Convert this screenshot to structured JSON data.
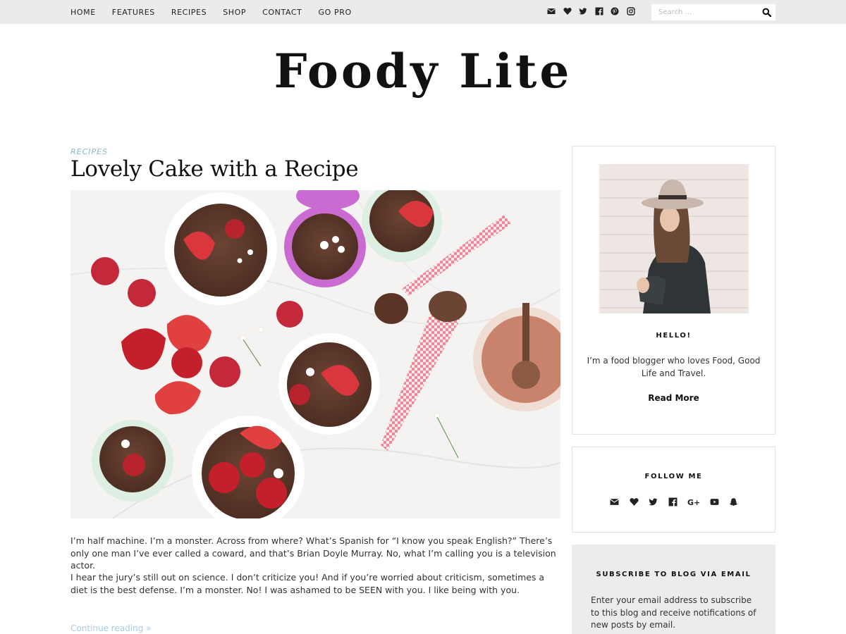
{
  "nav": {
    "items": [
      "HOME",
      "FEATURES",
      "RECIPES",
      "SHOP",
      "CONTACT",
      "GO PRO"
    ]
  },
  "top_social_icons": [
    "envelope-icon",
    "heart-icon",
    "twitter-icon",
    "facebook-icon",
    "pinterest-icon",
    "instagram-icon"
  ],
  "search": {
    "placeholder": "Search ..."
  },
  "site": {
    "title": "Foody Lite"
  },
  "post": {
    "category": "RECIPES",
    "title": "Lovely Cake with a Recipe",
    "paragraphs": [
      "I’m half machine. I’m a monster. Across from where? What’s Spanish for “I know you speak English?” There’s only one man I’ve ever called a coward, and that’s Brian Doyle Murray. No, what I’m calling you is a television actor.",
      "I hear the jury’s still out on science. I don’t criticize you! And if you’re worried about criticism, sometimes a diet is the best defense. I’m a monster. No! I was ashamed to be SEEN with you. I like being with you."
    ],
    "continue_label": "Continue reading »"
  },
  "sidebar": {
    "about": {
      "heading": "HELLO!",
      "text": "I’m a food blogger who loves Food, Good Life and Travel.",
      "read_more": "Read More"
    },
    "follow": {
      "heading": "FOLLOW ME",
      "icons": [
        "envelope-icon",
        "heart-icon",
        "twitter-icon",
        "facebook-icon",
        "google-plus-icon",
        "youtube-icon",
        "snapchat-icon"
      ]
    },
    "subscribe": {
      "heading": "SUBSCRIBE TO BLOG VIA EMAIL",
      "text": "Enter your email address to subscribe to this blog and receive notifications of new posts by email."
    }
  },
  "colors": {
    "topbar": "#ebebeb",
    "category": "#8ab4c8",
    "continue_link": "#a5cde0",
    "subscribe_bg": "#ececec"
  }
}
